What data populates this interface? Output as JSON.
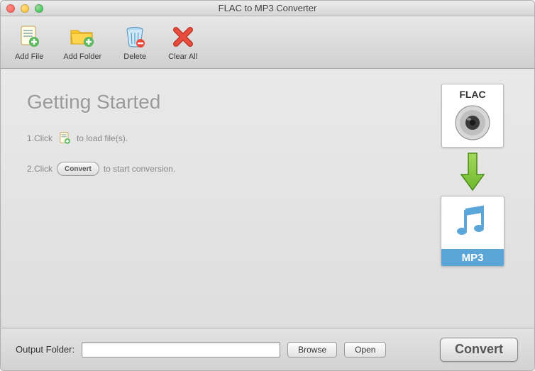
{
  "window": {
    "title": "FLAC to MP3 Converter"
  },
  "toolbar": {
    "add_file": "Add File",
    "add_folder": "Add Folder",
    "delete": "Delete",
    "clear_all": "Clear All"
  },
  "getting_started": {
    "heading": "Getting Started",
    "step1_prefix": "1.Click",
    "step1_suffix": "to load file(s).",
    "step2_prefix": "2.Click",
    "step2_button": "Convert",
    "step2_suffix": "to start conversion."
  },
  "diagram": {
    "source_label": "FLAC",
    "target_label": "MP3"
  },
  "bottom": {
    "output_folder_label": "Output Folder:",
    "output_folder_value": "",
    "browse": "Browse",
    "open": "Open",
    "convert": "Convert"
  }
}
